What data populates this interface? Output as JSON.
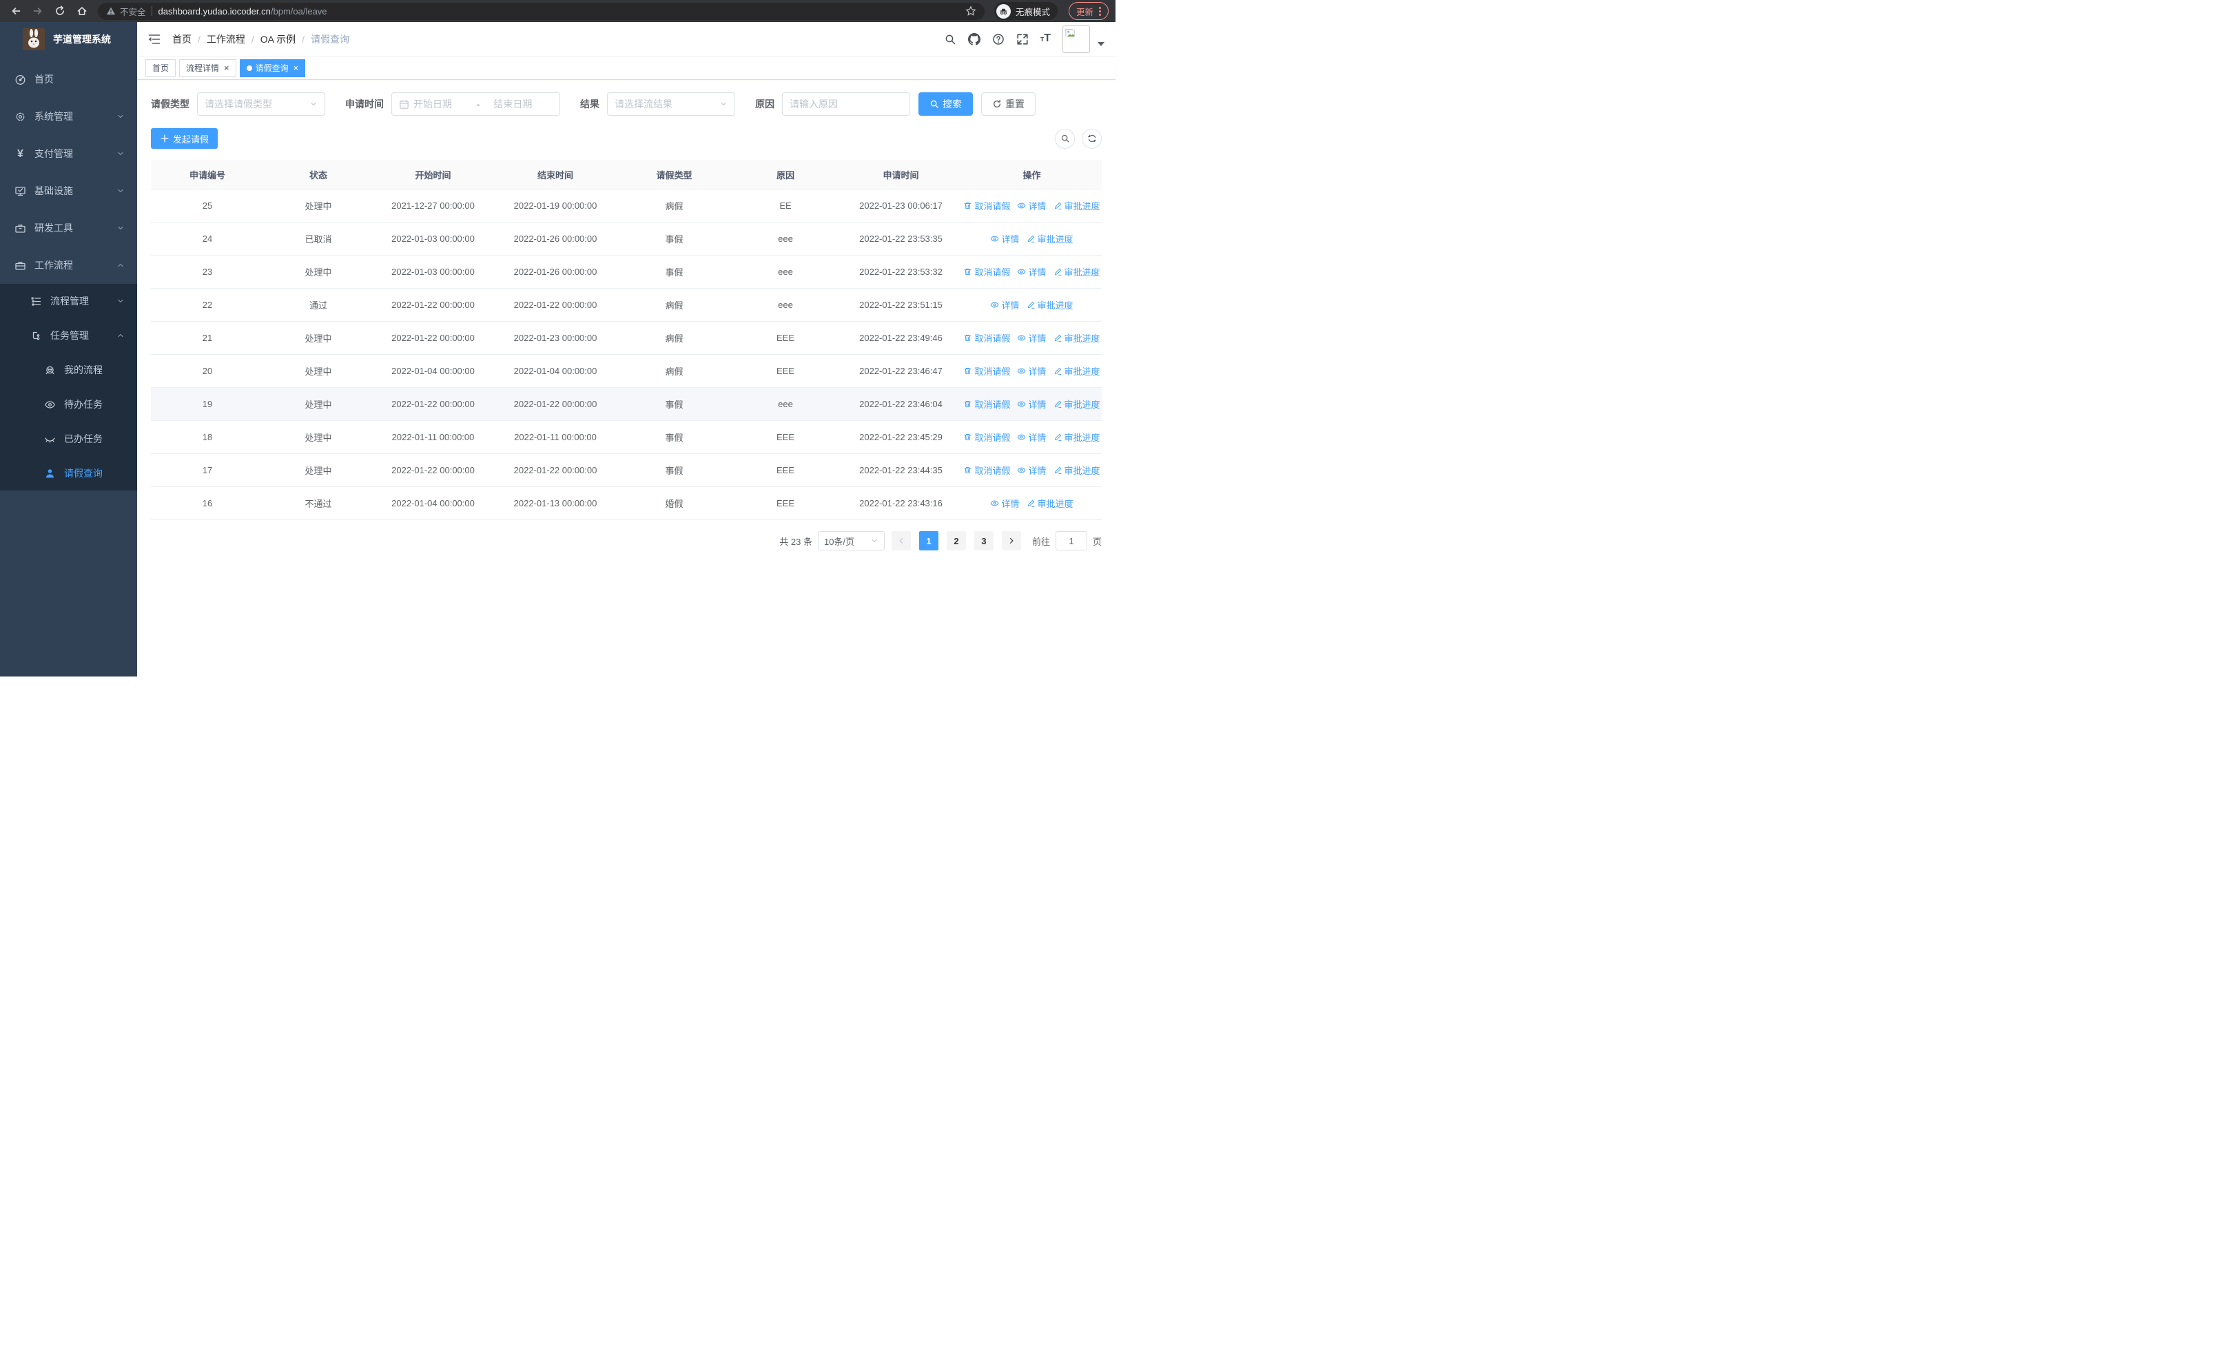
{
  "browser": {
    "security_label": "不安全",
    "url_domain": "dashboard.yudao.iocoder.cn",
    "url_path": "/bpm/oa/leave",
    "incognito_label": "无痕模式",
    "update_label": "更新"
  },
  "icons": {
    "close": "×",
    "yen": "¥",
    "font_size_small": "т",
    "font_size_large": "T"
  },
  "colors": {
    "primary": "#409eff",
    "sidebar_bg": "#304156",
    "submenu_bg": "#1f2d3d",
    "update_accent": "#f28b82"
  },
  "sidebar": {
    "title": "芋道管理系统",
    "menu": [
      {
        "label": "首页"
      },
      {
        "label": "系统管理"
      },
      {
        "label": "支付管理"
      },
      {
        "label": "基础设施"
      },
      {
        "label": "研发工具"
      },
      {
        "label": "工作流程"
      }
    ],
    "submenu": [
      {
        "label": "流程管理"
      },
      {
        "label": "任务管理"
      },
      {
        "label": "我的流程"
      },
      {
        "label": "待办任务"
      },
      {
        "label": "已办任务"
      },
      {
        "label": "请假查询"
      }
    ]
  },
  "navbar": {
    "breadcrumb": [
      "首页",
      "工作流程",
      "OA 示例",
      "请假查询"
    ],
    "separator": "/"
  },
  "tabs": [
    {
      "label": "首页",
      "closable": false,
      "active": false
    },
    {
      "label": "流程详情",
      "closable": true,
      "active": false
    },
    {
      "label": "请假查询",
      "closable": true,
      "active": true
    }
  ],
  "filters": {
    "leave_type_label": "请假类型",
    "leave_type_placeholder": "请选择请假类型",
    "apply_time_label": "申请时间",
    "start_placeholder": "开始日期",
    "range_separator": "-",
    "end_placeholder": "结束日期",
    "result_label": "结果",
    "result_placeholder": "请选择流结果",
    "reason_label": "原因",
    "reason_placeholder": "请输入原因",
    "search_label": "搜索",
    "reset_label": "重置"
  },
  "toolbar": {
    "create_label": "发起请假"
  },
  "table": {
    "columns": [
      "申请编号",
      "状态",
      "开始时间",
      "结束时间",
      "请假类型",
      "原因",
      "申请时间",
      "操作"
    ],
    "action_labels": {
      "cancel": "取消请假",
      "detail": "详情",
      "progress": "审批进度"
    },
    "rows": [
      {
        "id": "25",
        "status": "处理中",
        "start": "2021-12-27 00:00:00",
        "end": "2022-01-19 00:00:00",
        "type": "病假",
        "reason": "EE",
        "applied": "2022-01-23 00:06:17",
        "actions": [
          "cancel",
          "detail",
          "progress"
        ],
        "highlighted": false
      },
      {
        "id": "24",
        "status": "已取消",
        "start": "2022-01-03 00:00:00",
        "end": "2022-01-26 00:00:00",
        "type": "事假",
        "reason": "eee",
        "applied": "2022-01-22 23:53:35",
        "actions": [
          "detail",
          "progress"
        ],
        "highlighted": false
      },
      {
        "id": "23",
        "status": "处理中",
        "start": "2022-01-03 00:00:00",
        "end": "2022-01-26 00:00:00",
        "type": "事假",
        "reason": "eee",
        "applied": "2022-01-22 23:53:32",
        "actions": [
          "cancel",
          "detail",
          "progress"
        ],
        "highlighted": false
      },
      {
        "id": "22",
        "status": "通过",
        "start": "2022-01-22 00:00:00",
        "end": "2022-01-22 00:00:00",
        "type": "病假",
        "reason": "eee",
        "applied": "2022-01-22 23:51:15",
        "actions": [
          "detail",
          "progress"
        ],
        "highlighted": false
      },
      {
        "id": "21",
        "status": "处理中",
        "start": "2022-01-22 00:00:00",
        "end": "2022-01-23 00:00:00",
        "type": "病假",
        "reason": "EEE",
        "applied": "2022-01-22 23:49:46",
        "actions": [
          "cancel",
          "detail",
          "progress"
        ],
        "highlighted": false
      },
      {
        "id": "20",
        "status": "处理中",
        "start": "2022-01-04 00:00:00",
        "end": "2022-01-04 00:00:00",
        "type": "病假",
        "reason": "EEE",
        "applied": "2022-01-22 23:46:47",
        "actions": [
          "cancel",
          "detail",
          "progress"
        ],
        "highlighted": false
      },
      {
        "id": "19",
        "status": "处理中",
        "start": "2022-01-22 00:00:00",
        "end": "2022-01-22 00:00:00",
        "type": "事假",
        "reason": "eee",
        "applied": "2022-01-22 23:46:04",
        "actions": [
          "cancel",
          "detail",
          "progress"
        ],
        "highlighted": true
      },
      {
        "id": "18",
        "status": "处理中",
        "start": "2022-01-11 00:00:00",
        "end": "2022-01-11 00:00:00",
        "type": "事假",
        "reason": "EEE",
        "applied": "2022-01-22 23:45:29",
        "actions": [
          "cancel",
          "detail",
          "progress"
        ],
        "highlighted": false
      },
      {
        "id": "17",
        "status": "处理中",
        "start": "2022-01-22 00:00:00",
        "end": "2022-01-22 00:00:00",
        "type": "事假",
        "reason": "EEE",
        "applied": "2022-01-22 23:44:35",
        "actions": [
          "cancel",
          "detail",
          "progress"
        ],
        "highlighted": false
      },
      {
        "id": "16",
        "status": "不通过",
        "start": "2022-01-04 00:00:00",
        "end": "2022-01-13 00:00:00",
        "type": "婚假",
        "reason": "EEE",
        "applied": "2022-01-22 23:43:16",
        "actions": [
          "detail",
          "progress"
        ],
        "highlighted": false
      }
    ]
  },
  "pagination": {
    "total": "共 23 条",
    "per_page": "10条/页",
    "pages": [
      "1",
      "2",
      "3"
    ],
    "active_page": "1",
    "goto_label": "前往",
    "goto_value": "1",
    "page_unit": "页"
  }
}
